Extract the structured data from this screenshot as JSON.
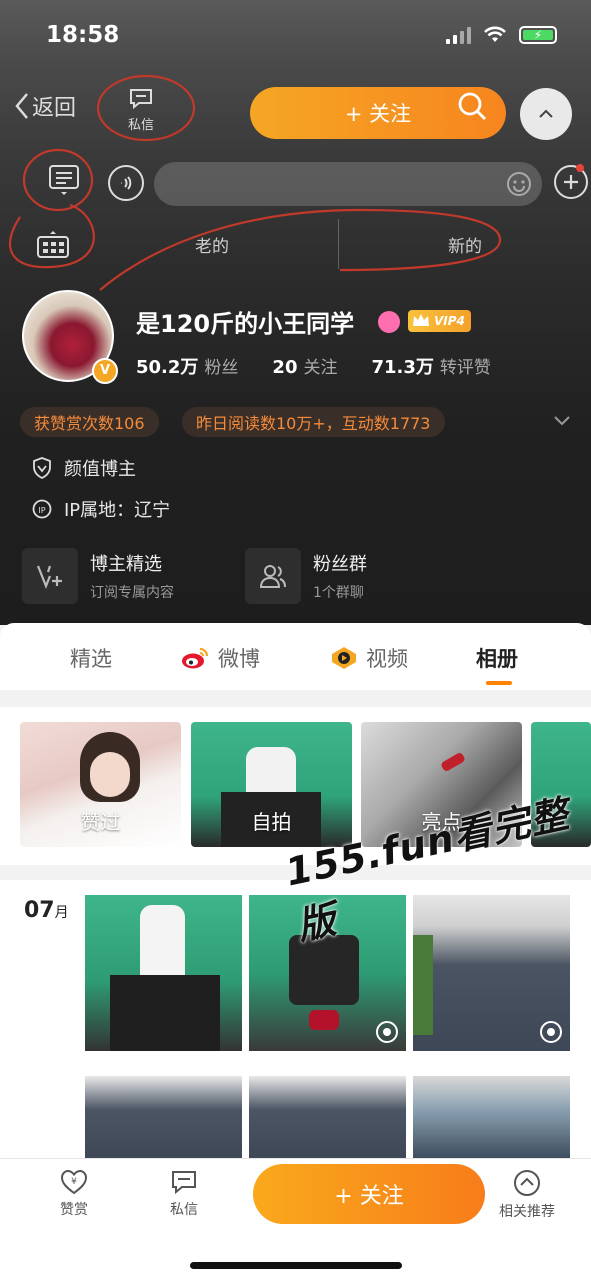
{
  "status": {
    "time": "18:58"
  },
  "nav": {
    "back_label": "返回",
    "message_label": "私信",
    "follow_label": "+ 关注"
  },
  "segments": {
    "old": "老的",
    "new": "新的"
  },
  "profile": {
    "name": "是120斤的小王同学",
    "vip_label": "VIP4",
    "followers_value": "50.2万",
    "followers_label": "粉丝",
    "following_value": "20",
    "following_label": "关注",
    "engagement_value": "71.3万",
    "engagement_label": "转评赞",
    "verified_badge": "V"
  },
  "tags": [
    "获赞赏次数106",
    "昨日阅读数10万+，互动数1773"
  ],
  "info": {
    "category": "颜值博主",
    "ip_location": "IP属地：辽宁"
  },
  "cards": [
    {
      "title": "博主精选",
      "subtitle": "订阅专属内容"
    },
    {
      "title": "粉丝群",
      "subtitle": "1个群聊"
    }
  ],
  "tabs": [
    {
      "label": "精选"
    },
    {
      "label": "微博"
    },
    {
      "label": "视频"
    },
    {
      "label": "相册"
    }
  ],
  "albums": [
    {
      "label": "赞过"
    },
    {
      "label": "自拍"
    },
    {
      "label": "亮点"
    },
    {
      "label": ""
    }
  ],
  "grid": {
    "month_number": "07",
    "month_unit": "月"
  },
  "watermark": "155.fun看完整版",
  "bottom": {
    "reward_label": "赞赏",
    "message_label": "私信",
    "follow_label": "+ 关注",
    "related_label": "相关推荐"
  },
  "colors": {
    "accent": "#ff8200",
    "follow_gradient_start": "#f5a623",
    "tag_text": "#f58a3a"
  }
}
